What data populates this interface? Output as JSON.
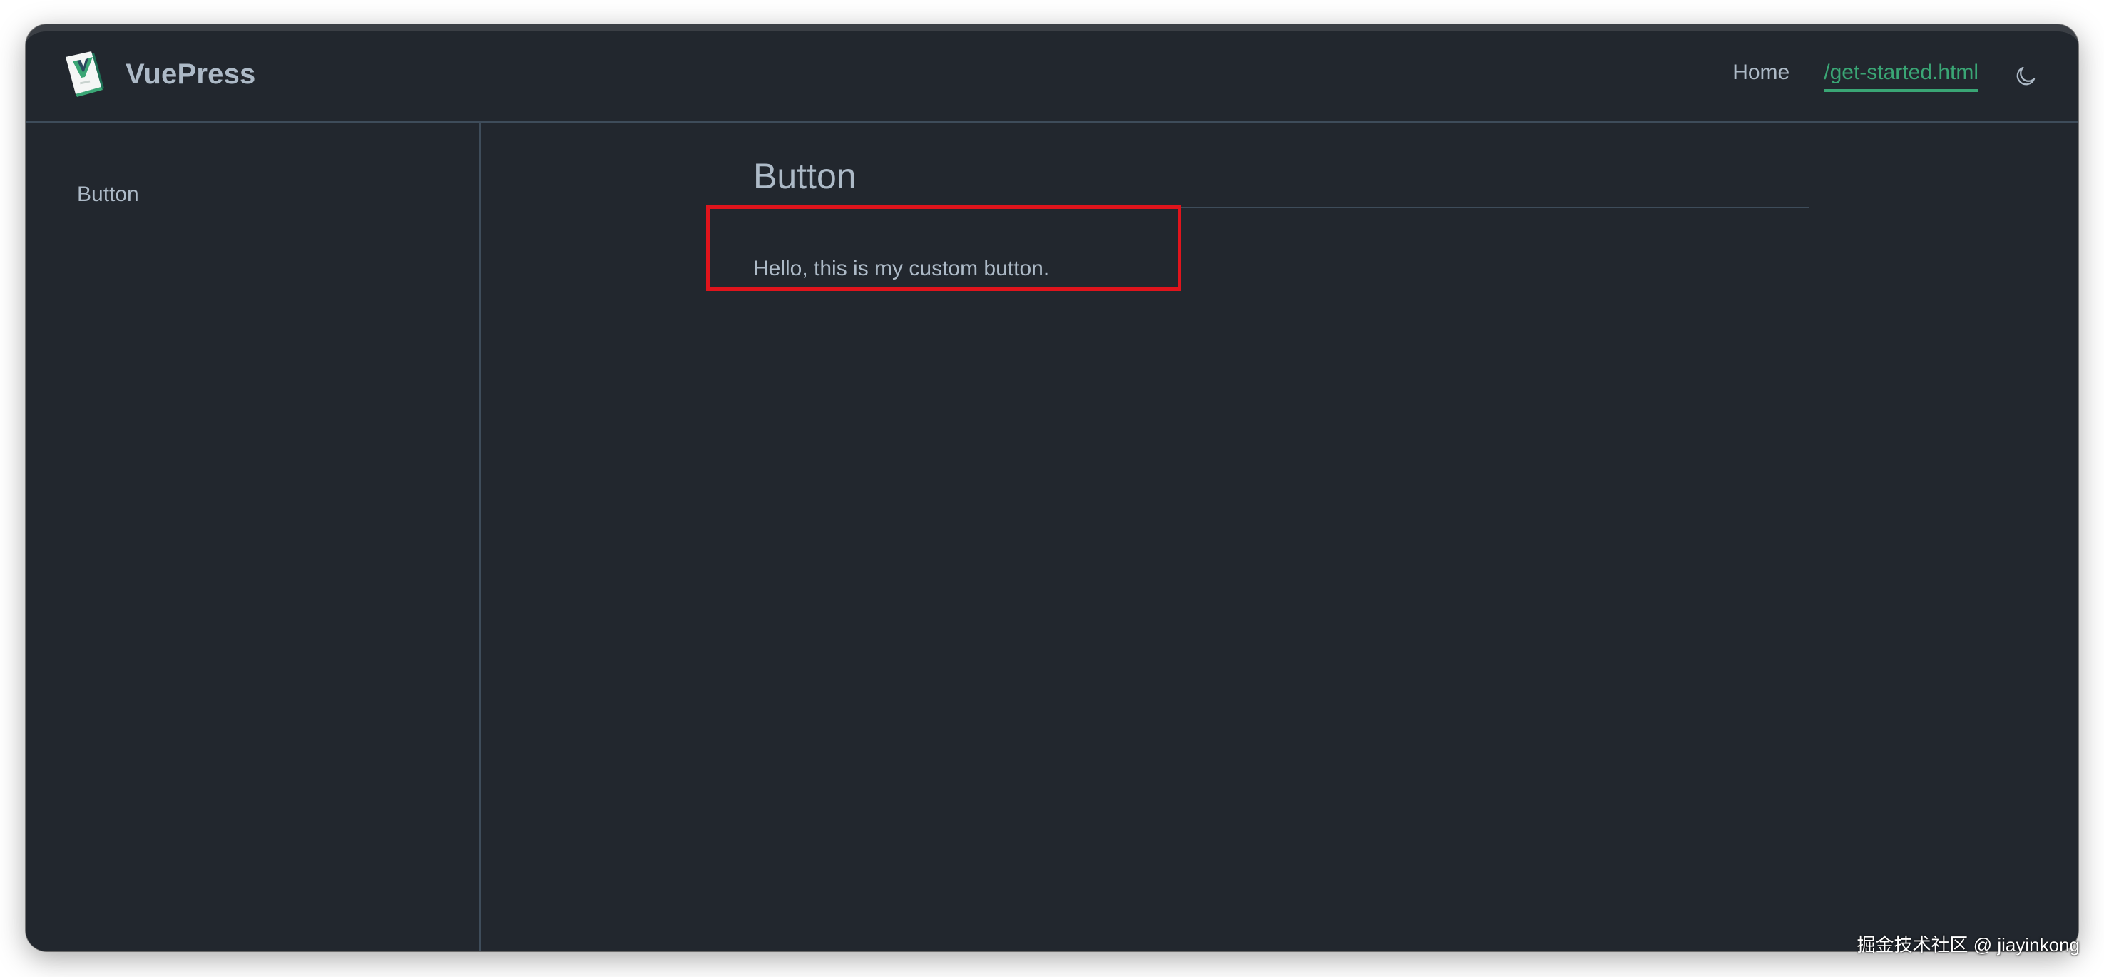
{
  "navbar": {
    "site_name": "VuePress",
    "links": [
      {
        "label": "Home",
        "active": false
      },
      {
        "label": "/get-started.html",
        "active": true
      }
    ],
    "theme_toggle_icon": "moon-icon"
  },
  "sidebar": {
    "items": [
      {
        "label": "Button"
      }
    ]
  },
  "main": {
    "title": "Button",
    "text": "Hello, this is my custom button."
  },
  "watermark": "掘金技术社区 @ jiayinkong",
  "colors": {
    "background": "#22272e",
    "text": "#adbac7",
    "accent": "#3aa675",
    "border": "#3e4c5a",
    "highlight": "#e0141c"
  }
}
